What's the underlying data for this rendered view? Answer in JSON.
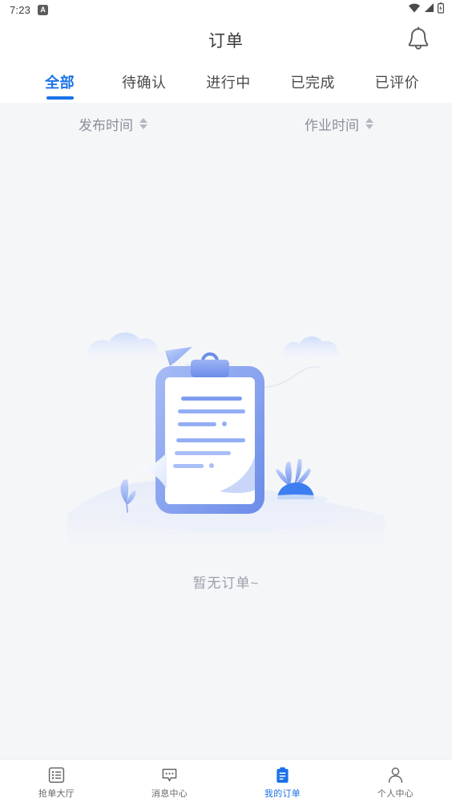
{
  "statusbar": {
    "time": "7:23",
    "badge_letter": "A",
    "icons": [
      "wifi-icon",
      "cellular-signal-icon",
      "battery-icon"
    ]
  },
  "header": {
    "title": "订单",
    "bell_icon": "notification-bell-icon"
  },
  "tabs": [
    {
      "label": "全部",
      "active": true
    },
    {
      "label": "待确认",
      "active": false
    },
    {
      "label": "进行中",
      "active": false
    },
    {
      "label": "已完成",
      "active": false
    },
    {
      "label": "已评价",
      "active": false
    }
  ],
  "filters": [
    {
      "label": "发布时间",
      "sort_icon": "sort-arrows-icon"
    },
    {
      "label": "作业时间",
      "sort_icon": "sort-arrows-icon"
    }
  ],
  "empty_state": {
    "illustration": "empty-clipboard-illustration",
    "text": "暂无订单~"
  },
  "bottom_nav": [
    {
      "label": "抢单大厅",
      "icon": "list-board-icon",
      "active": false
    },
    {
      "label": "消息中心",
      "icon": "chat-bubble-icon",
      "active": false
    },
    {
      "label": "我的订单",
      "icon": "clipboard-icon",
      "active": true
    },
    {
      "label": "个人中心",
      "icon": "person-icon",
      "active": false
    }
  ],
  "colors": {
    "accent": "#1b72e8",
    "header_bg": "#ffffff",
    "page_bg": "#f5f6f8",
    "text_primary": "#3a3a3a",
    "text_muted": "#9aa0ab",
    "illustration_blue": "#7b9aee"
  }
}
